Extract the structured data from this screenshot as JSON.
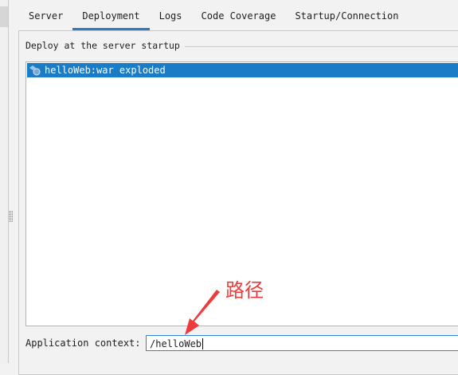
{
  "tabs": [
    {
      "label": "Server"
    },
    {
      "label": "Deployment"
    },
    {
      "label": "Logs"
    },
    {
      "label": "Code Coverage"
    },
    {
      "label": "Startup/Connection"
    }
  ],
  "active_tab": "Deployment",
  "deploy": {
    "title": "Deploy at the server startup",
    "items": [
      {
        "label": "helloWeb:war exploded",
        "icon": "artifact-icon",
        "selected": true
      }
    ]
  },
  "context": {
    "label": "Application context:",
    "value": "/helloWeb"
  },
  "annotation": {
    "text": "路径",
    "color": "#ee3b3b"
  }
}
